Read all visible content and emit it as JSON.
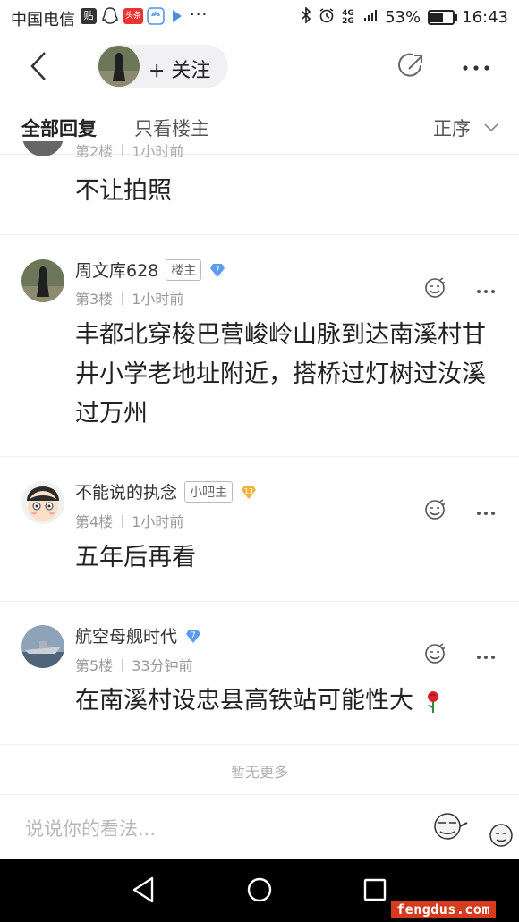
{
  "status_bar": {
    "carrier": "中国电信",
    "app_badge": "贴",
    "toutiao": "头条",
    "dots": "···",
    "network": "4G 2G",
    "battery": "53%",
    "time": "16:43"
  },
  "header": {
    "follow_label": "+ 关注"
  },
  "tabs": {
    "all": "全部回复",
    "owner_only": "只看楼主",
    "sort": "正序"
  },
  "posts": [
    {
      "content": "不让拍照",
      "floor_partial": "第2楼",
      "time_partial": "1小时前"
    },
    {
      "username": "周文库628",
      "role": "楼主",
      "level": "7",
      "floor": "第3楼",
      "time": "1小时前",
      "content": "丰都北穿梭巴营峻岭山脉到达南溪村甘井小学老地址附近，搭桥过灯树过汝溪过万州"
    },
    {
      "username": "不能说的执念",
      "role": "小吧主",
      "level": "13",
      "floor": "第4楼",
      "time": "1小时前",
      "content": "五年后再看"
    },
    {
      "username": "航空母舰时代",
      "level": "7",
      "floor": "第5楼",
      "time": "33分钟前",
      "content": "在南溪村设忠县高铁站可能性大"
    }
  ],
  "footer": {
    "no_more": "暂无更多",
    "input_placeholder": "说说你的看法..."
  },
  "watermark": "fengdus.com",
  "colors": {
    "level_blue": "#5b9df0",
    "level_gold": "#f0b23c",
    "watermark_bg": "#d63a1f"
  }
}
